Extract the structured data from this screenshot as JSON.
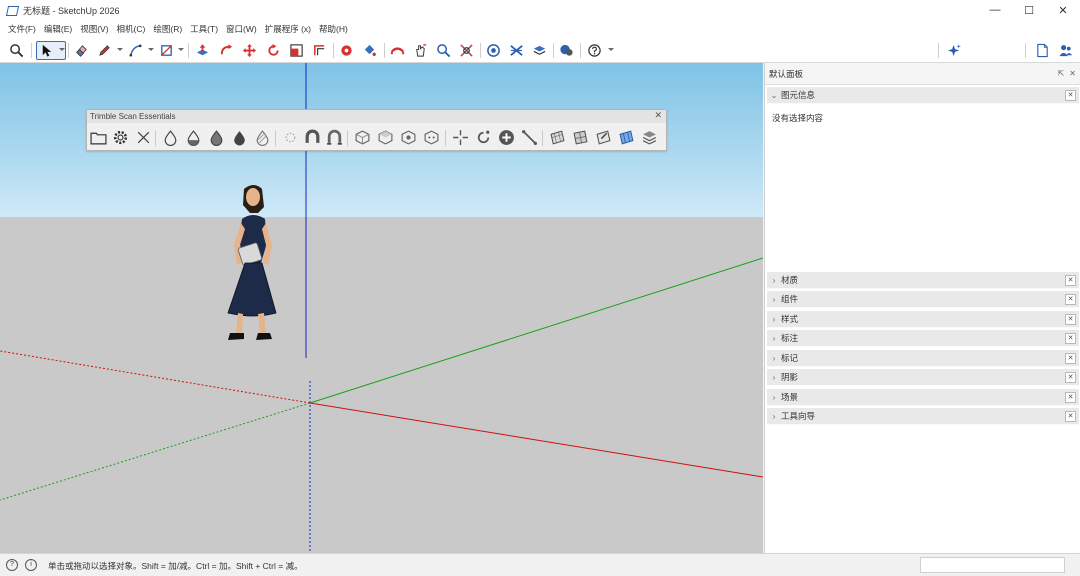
{
  "window": {
    "title": "无标题 - SketchUp 2026",
    "controls": {
      "minimize": "—",
      "maximize": "☐",
      "close": "✕"
    }
  },
  "menu": {
    "items": [
      "文件(F)",
      "编辑(E)",
      "视图(V)",
      "相机(C)",
      "绘图(R)",
      "工具(T)",
      "窗口(W)",
      "扩展程序 (x)",
      "帮助(H)"
    ]
  },
  "toolbar": {
    "icons": [
      "zoom-icon",
      "select-icon",
      "eraser-icon",
      "pencil-icon",
      "line-icon",
      "rectangle-icon",
      "push-pull-icon",
      "follow-me-icon",
      "move-icon",
      "rotate-icon",
      "scale-icon",
      "offset-icon",
      "tape-measure-icon",
      "paint-bucket-icon",
      "orbit-icon",
      "pan-icon",
      "zoom-window-icon",
      "zoom-extents-icon",
      "warehouse-icon",
      "extension-icon",
      "layers-icon",
      "chat-icon",
      "help-icon",
      "ai-sparkle-icon",
      "new-file-icon",
      "account-icon"
    ]
  },
  "float_toolbar": {
    "title": "Trimble Scan Essentials",
    "close": "✕"
  },
  "panel": {
    "title": "默认面板",
    "controls": [
      "⇱",
      "✕"
    ],
    "entity_info": {
      "label": "图元信息",
      "message": "没有选择内容"
    },
    "trays": [
      {
        "label": "材质"
      },
      {
        "label": "组件"
      },
      {
        "label": "样式"
      },
      {
        "label": "标注"
      },
      {
        "label": "标记"
      },
      {
        "label": "阴影"
      },
      {
        "label": "场景"
      },
      {
        "label": "工具向导"
      }
    ],
    "tray_close": "✕",
    "expand_arrow": "›",
    "collapse_arrow": "⌄"
  },
  "status": {
    "icon1": "?",
    "icon2": "i",
    "text": "单击或拖动以选择对象。Shift = 加/减。Ctrl = 加。Shift + Ctrl = 减。",
    "measurements": ""
  },
  "colors": {
    "sky": "#a9d7ef",
    "ground": "#c9c9c9",
    "axis_red": "#d01010",
    "axis_green": "#18a018",
    "axis_blue": "#1028c8"
  }
}
